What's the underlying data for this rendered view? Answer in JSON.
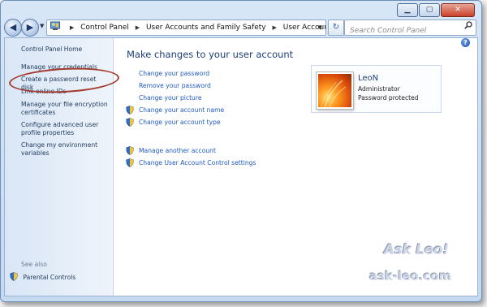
{
  "window": {
    "minimize_glyph": "▁",
    "maximize_glyph": "▢",
    "close_glyph": "✕"
  },
  "navigation": {
    "back_glyph": "◀",
    "forward_glyph": "▶",
    "dropdown_glyph": "▼",
    "breadcrumb": [
      "Control Panel",
      "User Accounts and Family Safety",
      "User Accounts"
    ],
    "breadcrumb_separator": "▶",
    "refresh_glyph": "↻",
    "search_placeholder": "Search Control Panel",
    "search_value": ""
  },
  "sidebar": {
    "home": "Control Panel Home",
    "tasks": [
      "Manage your credentials",
      "Create a password reset disk",
      "Link online IDs",
      "Manage your file encryption certificates",
      "Configure advanced user profile properties",
      "Change my environment variables"
    ],
    "see_also": "See also",
    "parental_controls": "Parental Controls"
  },
  "main": {
    "title": "Make changes to your user account",
    "links": [
      "Change your password",
      "Remove your password",
      "Change your picture",
      "Change your account name",
      "Change your account type"
    ],
    "other_links": [
      "Manage another account",
      "Change User Account Control settings"
    ]
  },
  "user": {
    "name": "LeoN",
    "role": "Administrator",
    "status": "Password protected"
  },
  "watermark": {
    "top": "Ask Leo!",
    "bottom": "ask-leo.com"
  },
  "colors": {
    "link": "#1f58c3",
    "title": "#1e3f77",
    "highlight_ring": "#a33a2d"
  },
  "icons": {
    "shield": "uac-shield-icon",
    "search": "magnifier-icon",
    "help": "help-icon"
  },
  "help_glyph": "?"
}
